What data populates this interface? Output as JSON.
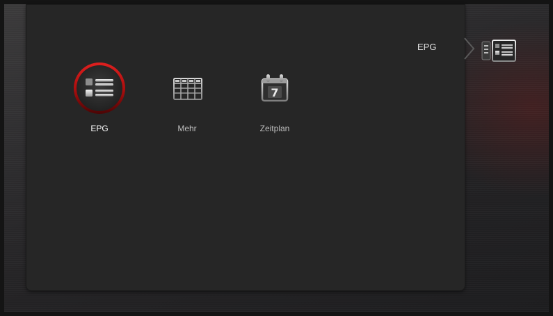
{
  "breadcrumb": {
    "label": "EPG",
    "icon": "epg-list-icon"
  },
  "menu": {
    "items": [
      {
        "label": "EPG",
        "icon": "epg-list-icon",
        "selected": true
      },
      {
        "label": "Mehr",
        "icon": "grid-table-icon",
        "selected": false
      },
      {
        "label": "Zeitplan",
        "icon": "calendar-icon",
        "selected": false,
        "calendar_day": "7"
      }
    ]
  },
  "colors": {
    "selection_ring": "#cc1111",
    "panel": "#262626",
    "text": "#e0e0e0"
  }
}
